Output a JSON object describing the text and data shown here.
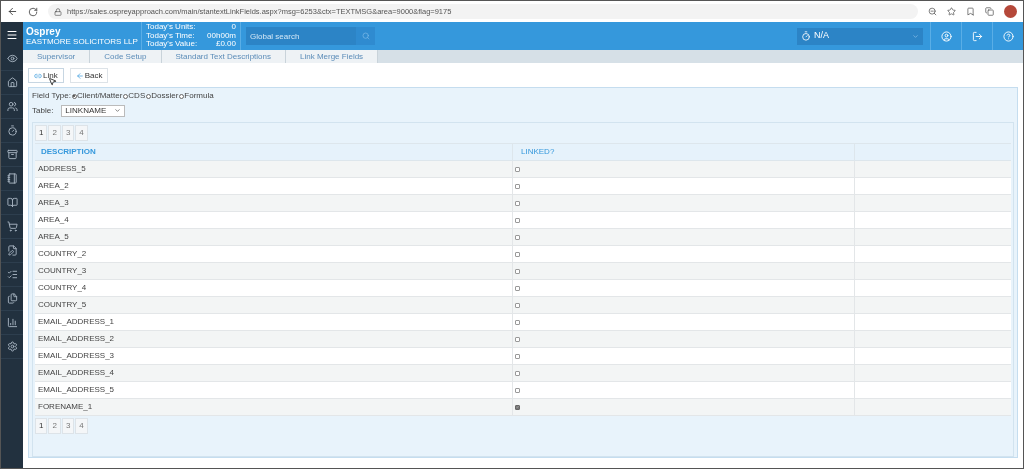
{
  "browser": {
    "url": "https://sales.ospreyapproach.com/main/stantextLinkFields.aspx?msg=6253&ctx=TEXTMSG&area=9000&flag=9175"
  },
  "header": {
    "logo": "Osprey",
    "firm": "EASTMORE SOLICITORS LLP",
    "stats": [
      {
        "label": "Today's Units:",
        "value": "0"
      },
      {
        "label": "Today's Time:",
        "value": "00h00m"
      },
      {
        "label": "Today's Value:",
        "value": "£0.00"
      }
    ],
    "search": {
      "placeholder": "Global search"
    },
    "timer": "N/A"
  },
  "breadcrumb": [
    "Supervisor",
    "Code Setup",
    "Standard Text Descriptions",
    "Link Merge Fields"
  ],
  "buttons": [
    "Link",
    "Back"
  ],
  "field_type": {
    "label": "Field Type:",
    "options": [
      {
        "label": "Client/Matter",
        "selected": true
      },
      {
        "label": "CDS",
        "selected": false
      },
      {
        "label": "Dossier",
        "selected": false
      },
      {
        "label": "Formula",
        "selected": false
      }
    ]
  },
  "table_select": {
    "label": "Table:",
    "value": "LINKNAME"
  },
  "pages_top": [
    {
      "label": "1",
      "selected": true
    },
    {
      "label": "2",
      "selected": false
    },
    {
      "label": "3",
      "selected": false
    },
    {
      "label": "4",
      "selected": false
    }
  ],
  "table": {
    "columns": [
      "DESCRIPTION",
      "LINKED?"
    ],
    "rows": [
      {
        "description": "ADDRESS_5",
        "checked": false
      },
      {
        "description": "AREA_2",
        "checked": false
      },
      {
        "description": "AREA_3",
        "checked": false
      },
      {
        "description": "AREA_4",
        "checked": false
      },
      {
        "description": "AREA_5",
        "checked": false
      },
      {
        "description": "COUNTRY_2",
        "checked": false
      },
      {
        "description": "COUNTRY_3",
        "checked": false
      },
      {
        "description": "COUNTRY_4",
        "checked": false
      },
      {
        "description": "COUNTRY_5",
        "checked": false
      },
      {
        "description": "EMAIL_ADDRESS_1",
        "checked": false
      },
      {
        "description": "EMAIL_ADDRESS_2",
        "checked": false
      },
      {
        "description": "EMAIL_ADDRESS_3",
        "checked": false
      },
      {
        "description": "EMAIL_ADDRESS_4",
        "checked": false
      },
      {
        "description": "EMAIL_ADDRESS_5",
        "checked": false
      },
      {
        "description": "FORENAME_1",
        "checked": true
      }
    ]
  },
  "pages_bottom": [
    {
      "label": "1",
      "selected": true
    },
    {
      "label": "2",
      "selected": false
    },
    {
      "label": "3",
      "selected": false
    },
    {
      "label": "4",
      "selected": false
    }
  ]
}
